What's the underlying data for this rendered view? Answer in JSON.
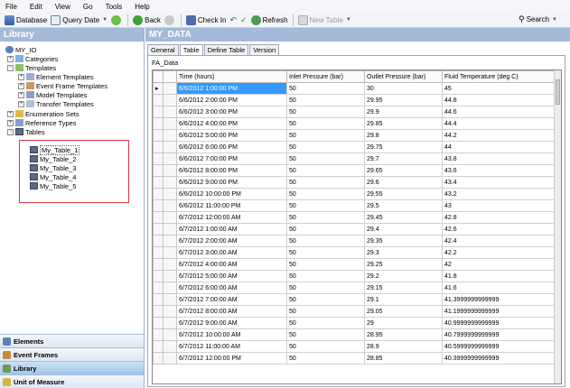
{
  "menu": [
    "File",
    "Edit",
    "View",
    "Go",
    "Tools",
    "Help"
  ],
  "toolbar": {
    "database": "Database",
    "query_date": "Query Date",
    "back": "Back",
    "check_in": "Check In",
    "refresh": "Refresh",
    "new_table": "New Table",
    "search": "Search"
  },
  "library": {
    "title": "Library",
    "root": "MY_IO",
    "categories": "Categories",
    "templates": "Templates",
    "template_items": [
      "Element Templates",
      "Event Frame Templates",
      "Model Templates",
      "Transfer Templates"
    ],
    "enumeration_sets": "Enumeration Sets",
    "reference_types": "Reference Types",
    "tables": "Tables",
    "table_items": [
      "My_Table_1",
      "My_Table_2",
      "My_Table_3",
      "My_Table_4",
      "My_Table_5"
    ]
  },
  "nav": [
    "Elements",
    "Event Frames",
    "Library",
    "Unit of Measure"
  ],
  "main": {
    "title": "MY_DATA",
    "tabs": [
      "General",
      "Table",
      "Define Table",
      "Version"
    ],
    "table_name": "FA_Data",
    "columns": [
      "Time (hours)",
      "Inlet Pressure (bar)",
      "Outlet Pressure (bar)",
      "Fluid Temperature (deg C)"
    ],
    "rows": [
      [
        "6/6/2012 1:00:00 PM",
        "50",
        "30",
        "45"
      ],
      [
        "6/6/2012 2:00:00 PM",
        "50",
        "29.95",
        "44.8"
      ],
      [
        "6/6/2012 3:00:00 PM",
        "50",
        "29.9",
        "44.6"
      ],
      [
        "6/6/2012 4:00:00 PM",
        "50",
        "29.85",
        "44.4"
      ],
      [
        "6/6/2012 5:00:00 PM",
        "50",
        "29.8",
        "44.2"
      ],
      [
        "6/6/2012 6:00:00 PM",
        "50",
        "29.75",
        "44"
      ],
      [
        "6/6/2012 7:00:00 PM",
        "50",
        "29.7",
        "43.8"
      ],
      [
        "6/6/2012 8:00:00 PM",
        "50",
        "29.65",
        "43.6"
      ],
      [
        "6/6/2012 9:00:00 PM",
        "50",
        "29.6",
        "43.4"
      ],
      [
        "6/6/2012 10:00:00 PM",
        "50",
        "29.55",
        "43.2"
      ],
      [
        "6/6/2012 11:00:00 PM",
        "50",
        "29.5",
        "43"
      ],
      [
        "6/7/2012 12:00:00 AM",
        "50",
        "29.45",
        "42.8"
      ],
      [
        "6/7/2012 1:00:00 AM",
        "50",
        "29.4",
        "42.6"
      ],
      [
        "6/7/2012 2:00:00 AM",
        "50",
        "29.35",
        "42.4"
      ],
      [
        "6/7/2012 3:00:00 AM",
        "50",
        "29.3",
        "42.2"
      ],
      [
        "6/7/2012 4:00:00 AM",
        "50",
        "29.25",
        "42"
      ],
      [
        "6/7/2012 5:00:00 AM",
        "50",
        "29.2",
        "41.8"
      ],
      [
        "6/7/2012 6:00:00 AM",
        "50",
        "29.15",
        "41.6"
      ],
      [
        "6/7/2012 7:00:00 AM",
        "50",
        "29.1",
        "41.3999999999999"
      ],
      [
        "6/7/2012 8:00:00 AM",
        "50",
        "29.05",
        "41.1999999999999"
      ],
      [
        "6/7/2012 9:00:00 AM",
        "50",
        "29",
        "40.9999999999999"
      ],
      [
        "6/7/2012 10:00:00 AM",
        "50",
        "28.95",
        "40.7999999999999"
      ],
      [
        "6/7/2012 11:00:00 AM",
        "50",
        "28.9",
        "40.5999999999999"
      ],
      [
        "6/7/2012 12:00:00 PM",
        "50",
        "28.85",
        "40.3999999999999"
      ]
    ]
  },
  "colors": {
    "panel_header": "#a5b9d8",
    "selection": "#3399ff",
    "highlight_box": "#e0383e"
  }
}
